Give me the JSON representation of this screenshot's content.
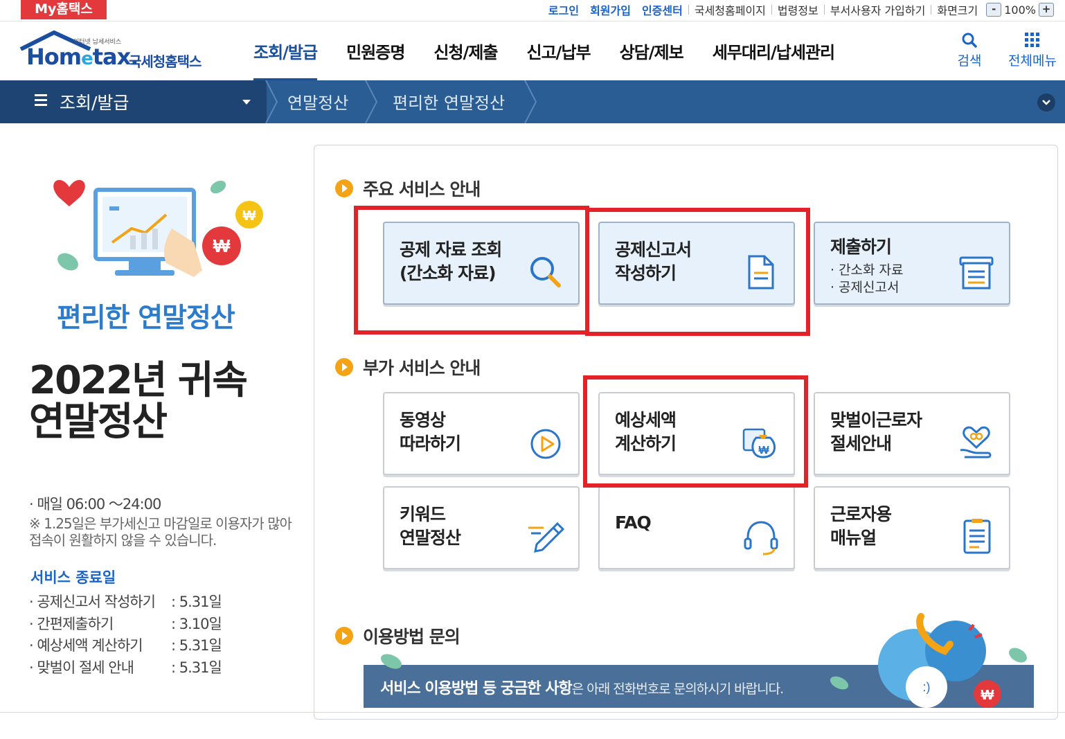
{
  "topbar": {
    "mytax": "My홈택스",
    "links": [
      "로그인",
      "회원가입",
      "인증센터",
      "국세청홈페이지",
      "법령정보",
      "부서사용자 가입하기",
      "화면크기"
    ],
    "zoom_minus": "-",
    "zoom_value": "100%",
    "zoom_plus": "+"
  },
  "header": {
    "logo_small": "인터넷 납세서비스",
    "logo_word_a": "Hom",
    "logo_word_e": "e",
    "logo_word_b": "tax.",
    "logo_kor": "국세청홈택스",
    "gnb": [
      "조회/발급",
      "민원증명",
      "신청/제출",
      "신고/납부",
      "상담/제보",
      "세무대리/납세관리"
    ],
    "search_label": "검색",
    "menu_label": "전체메뉴"
  },
  "breadcrumb": {
    "main": "조회/발급",
    "items": [
      "연말정산",
      "편리한 연말정산"
    ]
  },
  "promo": {
    "title": "편리한 연말정산",
    "year_line1": "2022년 귀속",
    "year_line2": "연말정산",
    "hours": "· 매일 06:00 ～24:00",
    "notice": "※ 1.25일은 부가세신고 마감일로 이용자가 많아 접속이 원활하지 않을 수 있습니다.",
    "end_title": "서비스 종료일",
    "end_items": [
      {
        "name": "· 공제신고서 작성하기",
        "date": ": 5.31일"
      },
      {
        "name": "· 간편제출하기",
        "date": ": 3.10일"
      },
      {
        "name": "· 예상세액 계산하기",
        "date": ": 5.31일"
      },
      {
        "name": "· 맞벌이 절세 안내",
        "date": ": 5.31일"
      }
    ]
  },
  "main_services": {
    "heading": "주요 서비스 안내",
    "cards": [
      {
        "title1": "공제 자료 조회",
        "title2": "(간소화 자료)",
        "icon": "magnifier-icon"
      },
      {
        "title1": "공제신고서",
        "title2": "작성하기",
        "icon": "document-icon"
      },
      {
        "title1": "제출하기",
        "sub1": "· 간소화 자료",
        "sub2": "· 공제신고서",
        "icon": "submit-tray-icon"
      }
    ]
  },
  "extra_services": {
    "heading": "부가 서비스 안내",
    "cards": [
      {
        "title1": "동영상",
        "title2": "따라하기",
        "icon": "play-icon"
      },
      {
        "title1": "예상세액",
        "title2": "계산하기",
        "icon": "money-bag-icon"
      },
      {
        "title1": "맞벌이근로자",
        "title2": "절세안내",
        "icon": "heart-hand-icon"
      },
      {
        "title1": "키워드",
        "title2": "연말정산",
        "icon": "pencil-icon"
      },
      {
        "title1": "FAQ",
        "title2": "",
        "icon": "headset-icon"
      },
      {
        "title1": "근로자용",
        "title2": "매뉴얼",
        "icon": "manual-icon"
      }
    ]
  },
  "inquiry": {
    "heading": "이용방법 문의",
    "banner_bold": "서비스 이용방법 등 궁금한 사항",
    "banner_rest": "은 아래 전화번호로 문의하시기 바랍니다."
  },
  "colors": {
    "highlight": "#e2232a",
    "brand_blue": "#1a4f9c",
    "breadcrumb_bg": "#2b5d95",
    "bullet_orange": "#f4a314"
  }
}
